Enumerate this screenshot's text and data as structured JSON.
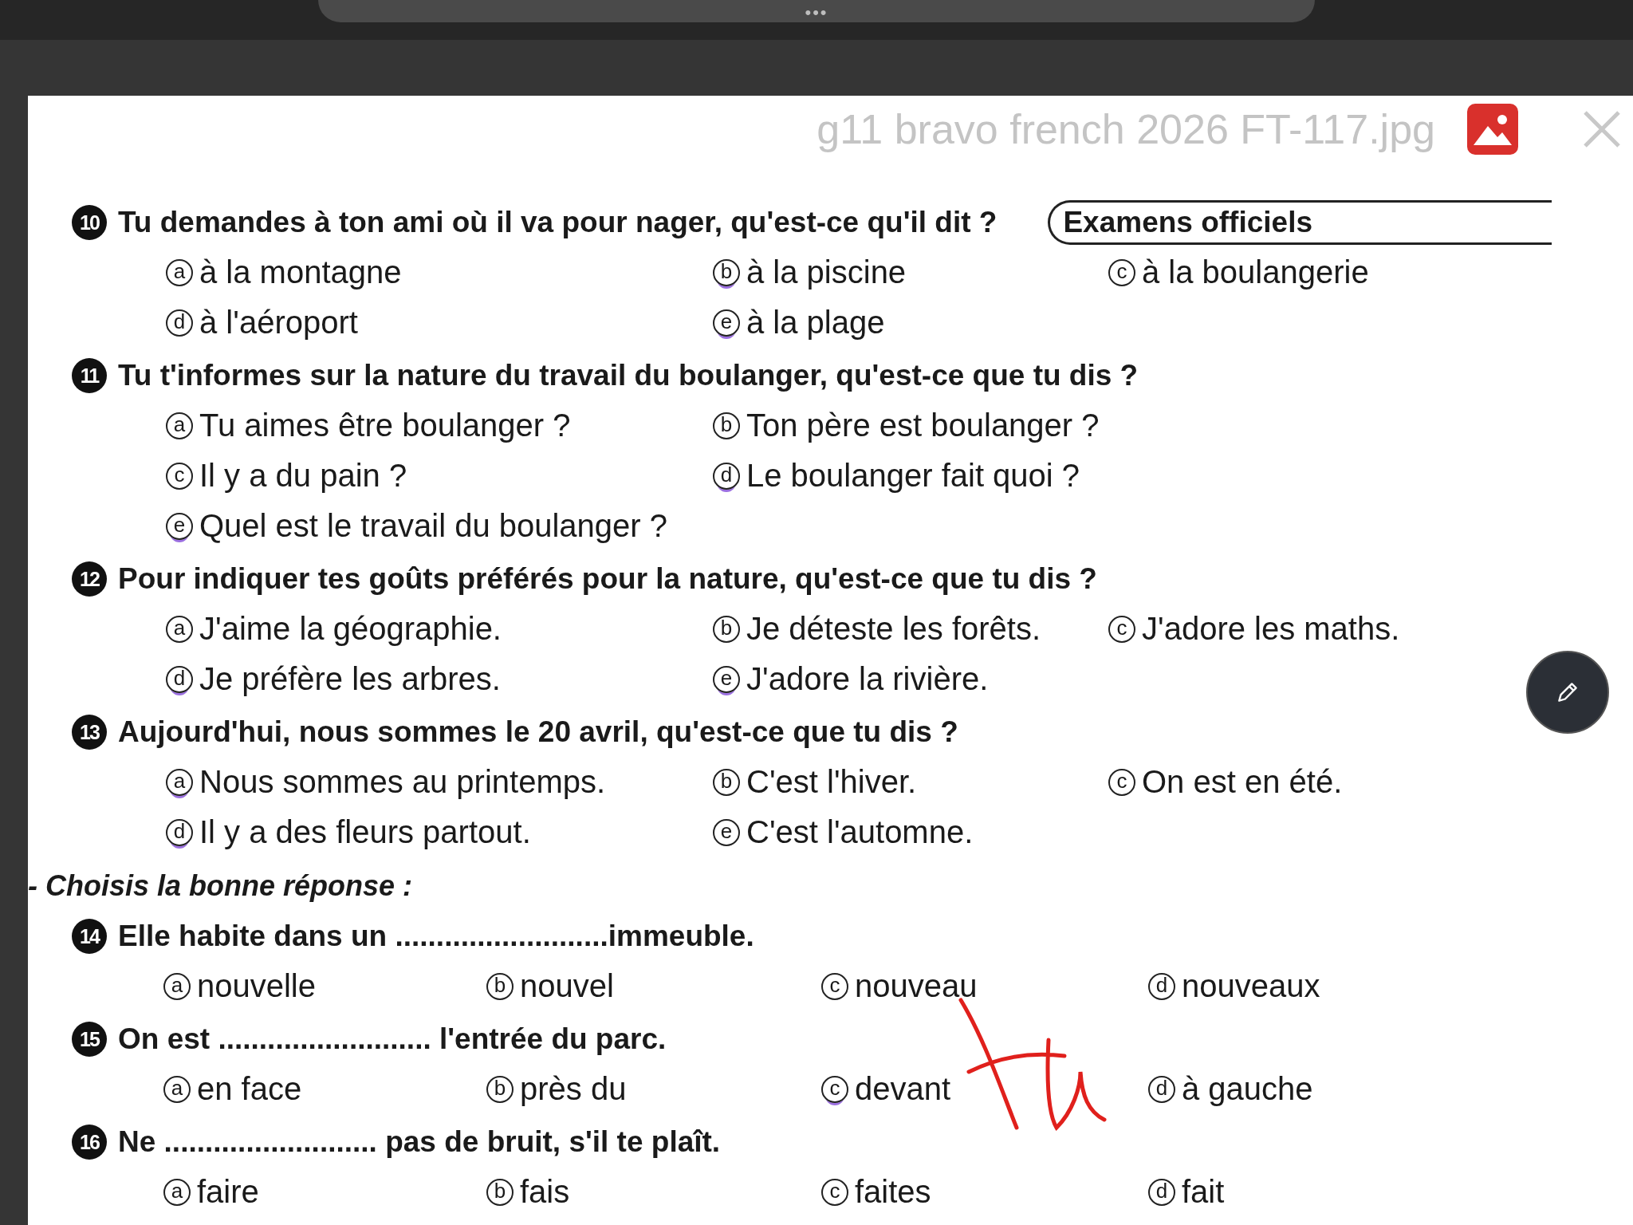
{
  "window": {
    "title": "g11 bravo french 2026 FT-117.jpg",
    "dots": "•••"
  },
  "document": {
    "badge": "Examens officiels",
    "parts": [
      {
        "questions": [
          {
            "number": "10",
            "text": "Tu demandes à ton ami où il va pour nager, qu'est-ce qu'il dit ?",
            "rows": [
              [
                {
                  "letter": "a",
                  "text": "à la montagne",
                  "marked": false
                },
                {
                  "letter": "b",
                  "text": "à la piscine",
                  "marked": true
                },
                {
                  "letter": "c",
                  "text": "à la boulangerie",
                  "marked": false
                }
              ],
              [
                {
                  "letter": "d",
                  "text": "à l'aéroport",
                  "marked": false
                },
                {
                  "letter": "e",
                  "text": "à la plage",
                  "marked": true
                }
              ]
            ]
          },
          {
            "number": "11",
            "text": "Tu t'informes sur la nature du travail du boulanger, qu'est-ce que tu dis ?",
            "rows": [
              [
                {
                  "letter": "a",
                  "text": "Tu aimes être boulanger ?",
                  "marked": false
                },
                {
                  "letter": "b",
                  "text": "Ton père est boulanger ?",
                  "marked": false
                }
              ],
              [
                {
                  "letter": "c",
                  "text": "Il y a du pain ?",
                  "marked": false
                },
                {
                  "letter": "d",
                  "text": "Le boulanger fait quoi ?",
                  "marked": true
                }
              ],
              [
                {
                  "letter": "e",
                  "text": "Quel est le travail du boulanger ?",
                  "marked": true
                }
              ]
            ]
          },
          {
            "number": "12",
            "text": "Pour indiquer tes goûts préférés pour la nature, qu'est-ce que tu dis ?",
            "rows": [
              [
                {
                  "letter": "a",
                  "text": "J'aime la géographie.",
                  "marked": false
                },
                {
                  "letter": "b",
                  "text": "Je déteste les forêts.",
                  "marked": false
                },
                {
                  "letter": "c",
                  "text": "J'adore les maths.",
                  "marked": false
                }
              ],
              [
                {
                  "letter": "d",
                  "text": "Je préfère les arbres.",
                  "marked": true
                },
                {
                  "letter": "e",
                  "text": "J'adore la rivière.",
                  "marked": true
                }
              ]
            ]
          },
          {
            "number": "13",
            "text": "Aujourd'hui, nous sommes le 20 avril, qu'est-ce que tu dis ?",
            "rows": [
              [
                {
                  "letter": "a",
                  "text": "Nous sommes au printemps.",
                  "marked": true
                },
                {
                  "letter": "b",
                  "text": "C'est l'hiver.",
                  "marked": false
                },
                {
                  "letter": "c",
                  "text": "On est en été.",
                  "marked": false
                }
              ],
              [
                {
                  "letter": "d",
                  "text": "Il y a des fleurs partout.",
                  "marked": true
                },
                {
                  "letter": "e",
                  "text": "C'est l'automne.",
                  "marked": false
                }
              ]
            ]
          }
        ]
      },
      {
        "heading": "- Choisis la bonne réponse :",
        "questions": [
          {
            "number": "14",
            "text": "Elle habite dans un ..........................immeuble.",
            "rows": [
              [
                {
                  "letter": "a",
                  "text": "nouvelle",
                  "marked": false
                },
                {
                  "letter": "b",
                  "text": "nouvel",
                  "marked": false
                },
                {
                  "letter": "c",
                  "text": "nouveau",
                  "marked": false
                },
                {
                  "letter": "d",
                  "text": "nouveaux",
                  "marked": false
                }
              ]
            ]
          },
          {
            "number": "15",
            "text": "On est .......................... l'entrée du parc.",
            "rows": [
              [
                {
                  "letter": "a",
                  "text": "en face",
                  "marked": false
                },
                {
                  "letter": "b",
                  "text": "près du",
                  "marked": false
                },
                {
                  "letter": "c",
                  "text": "devant",
                  "marked": true
                },
                {
                  "letter": "d",
                  "text": "à gauche",
                  "marked": false
                }
              ]
            ]
          },
          {
            "number": "16",
            "text": "Ne .......................... pas de bruit, s'il te plaît.",
            "rows": [
              [
                {
                  "letter": "a",
                  "text": "faire",
                  "marked": false
                },
                {
                  "letter": "b",
                  "text": "fais",
                  "marked": false
                },
                {
                  "letter": "c",
                  "text": "faites",
                  "marked": false
                },
                {
                  "letter": "d",
                  "text": "fait",
                  "marked": false
                }
              ]
            ]
          }
        ]
      }
    ]
  }
}
